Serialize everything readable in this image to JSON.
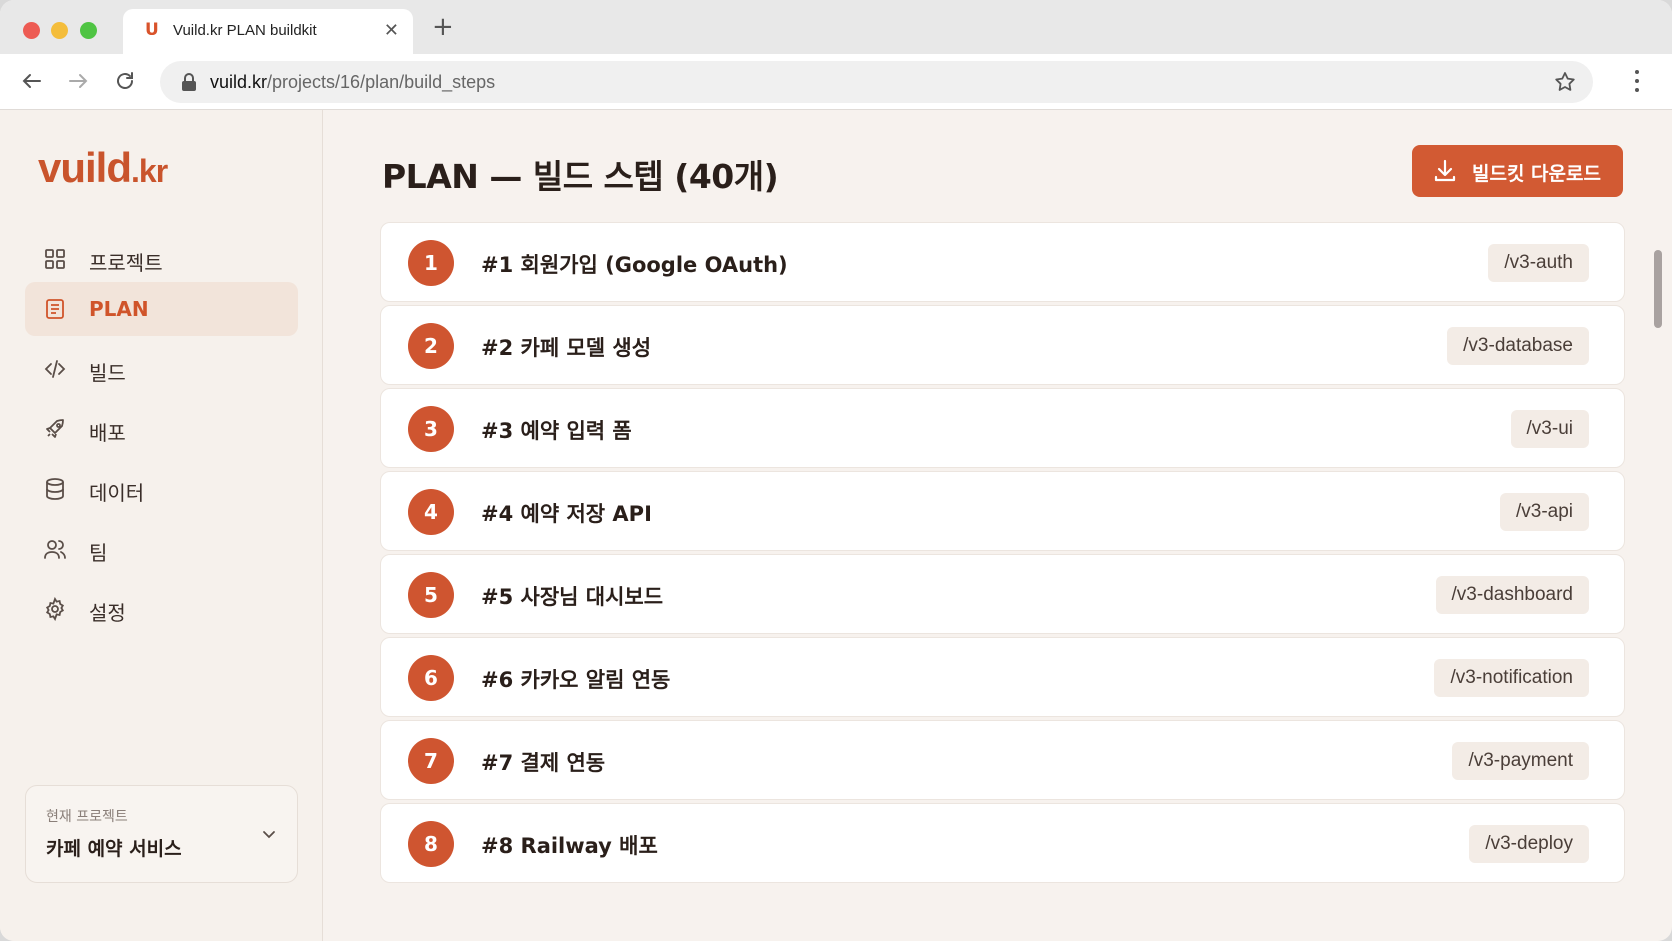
{
  "browser": {
    "tab_title": "Vuild.kr PLAN buildkit",
    "favicon_letter": "U",
    "url_host": "vuild.kr",
    "url_path": "/projects/16/plan/build_steps"
  },
  "sidebar": {
    "logo_main": "vuild",
    "logo_tld": ".kr",
    "items": [
      {
        "label": "프로젝트",
        "icon": "grid-icon"
      },
      {
        "label": "PLAN",
        "icon": "document-icon",
        "active": true
      },
      {
        "label": "빌드",
        "icon": "code-icon"
      },
      {
        "label": "배포",
        "icon": "rocket-icon"
      },
      {
        "label": "데이터",
        "icon": "database-icon"
      },
      {
        "label": "팀",
        "icon": "users-icon"
      },
      {
        "label": "설정",
        "icon": "gear-icon"
      }
    ],
    "project_caption": "현재 프로젝트",
    "project_name": "카페 예약 서비스"
  },
  "main": {
    "title": "PLAN — 빌드 스텝 (40개)",
    "download_label": "빌드킷 다운로드",
    "steps": [
      {
        "num": "1",
        "title": "#1 회원가입 (Google OAuth)",
        "cmd": "/v3-auth"
      },
      {
        "num": "2",
        "title": "#2 카페 모델 생성",
        "cmd": "/v3-database"
      },
      {
        "num": "3",
        "title": "#3 예약 입력 폼",
        "cmd": "/v3-ui"
      },
      {
        "num": "4",
        "title": "#4 예약 저장 API",
        "cmd": "/v3-api"
      },
      {
        "num": "5",
        "title": "#5 사장님 대시보드",
        "cmd": "/v3-dashboard"
      },
      {
        "num": "6",
        "title": "#6 카카오 알림 연동",
        "cmd": "/v3-notification"
      },
      {
        "num": "7",
        "title": "#7 결제 연동",
        "cmd": "/v3-payment"
      },
      {
        "num": "8",
        "title": "#8 Railway 배포",
        "cmd": "/v3-deploy"
      }
    ]
  },
  "colors": {
    "accent": "#d25a33",
    "sidebar_bg": "#f6f1ec",
    "active_bg": "#f2e4da"
  }
}
